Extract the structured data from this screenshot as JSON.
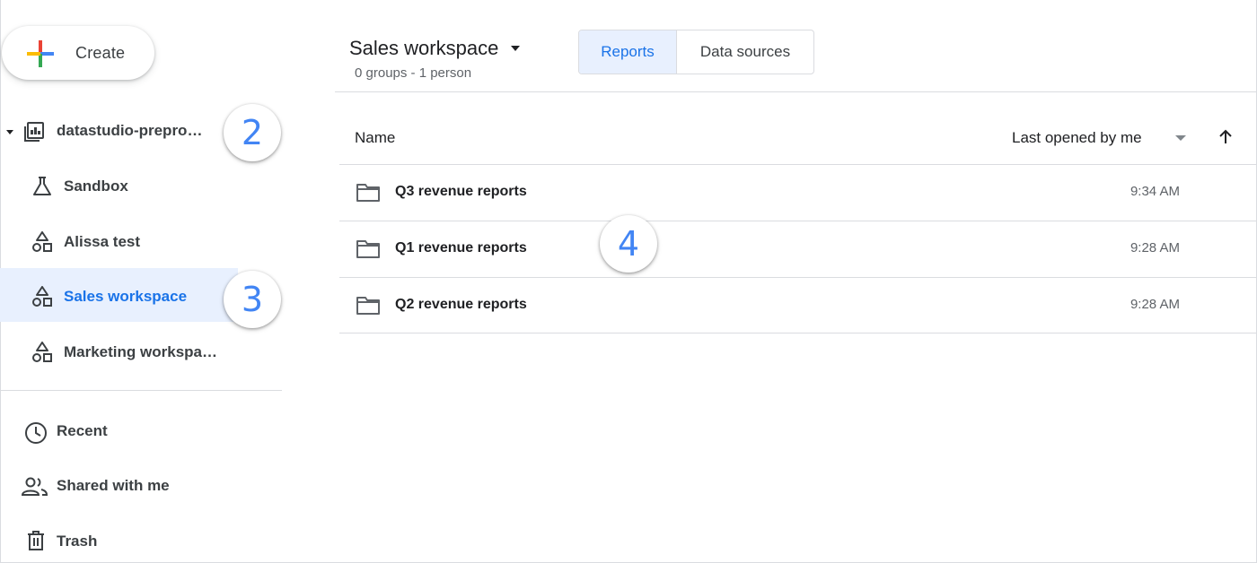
{
  "create": {
    "label": "Create",
    "icon": "plus-icon"
  },
  "sidebar": {
    "project": {
      "label": "datastudio-prepro…",
      "icon": "project-icon"
    },
    "workspaces": [
      {
        "label": "Sandbox",
        "icon": "flask-icon"
      },
      {
        "label": "Alissa test",
        "icon": "shapes-icon"
      },
      {
        "label": "Sales workspace",
        "icon": "shapes-icon",
        "active": true
      },
      {
        "label": "Marketing workspa…",
        "icon": "shapes-icon"
      }
    ],
    "nav": [
      {
        "label": "Recent",
        "icon": "clock-icon"
      },
      {
        "label": "Shared with me",
        "icon": "people-icon"
      },
      {
        "label": "Trash",
        "icon": "trash-icon"
      }
    ]
  },
  "header": {
    "title": "Sales workspace",
    "subtitle": "0 groups - 1 person",
    "tabs": [
      {
        "label": "Reports",
        "active": true
      },
      {
        "label": "Data sources",
        "active": false
      }
    ]
  },
  "table": {
    "columns": {
      "name": "Name",
      "sort": "Last opened by me"
    },
    "rows": [
      {
        "name": "Q3 revenue reports",
        "time": "9:34 AM"
      },
      {
        "name": "Q1 revenue reports",
        "time": "9:28 AM"
      },
      {
        "name": "Q2 revenue reports",
        "time": "9:28 AM"
      }
    ]
  },
  "callouts": [
    "2",
    "3",
    "4"
  ],
  "colors": {
    "accent": "#1a73e8",
    "active_bg": "#e8f0fe",
    "callout": "#4285f4"
  }
}
